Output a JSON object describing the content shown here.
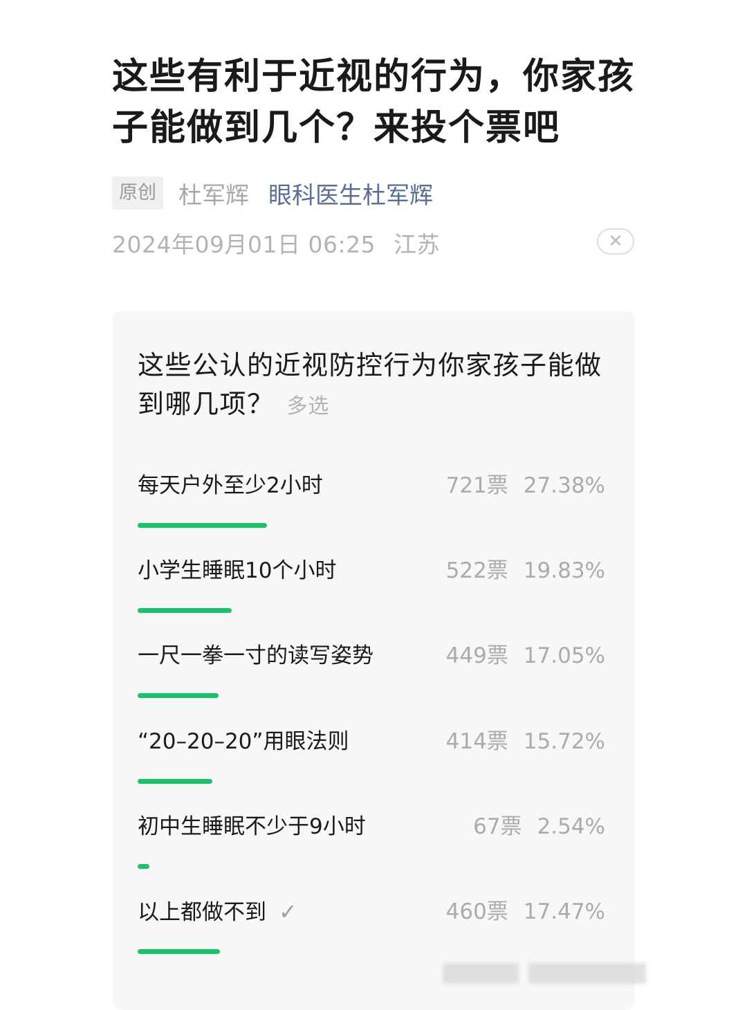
{
  "article": {
    "title": "这些有利于近视的行为，你家孩子能做到几个？来投个票吧",
    "original_badge": "原创",
    "author": "杜军辉",
    "account": "眼科医生杜军辉",
    "datetime": "2024年09月01日 06:25",
    "location": "江苏",
    "close_icon": "close-icon"
  },
  "vote": {
    "question": "这些公认的近视防控行为你家孩子能做到哪几项？",
    "type_tag": "多选",
    "options": [
      {
        "label": "每天户外至少2小时",
        "votes": "721票",
        "percent": "27.38%",
        "fraction": 0.2738
      },
      {
        "label": "小学生睡眠10个小时",
        "votes": "522票",
        "percent": "19.83%",
        "fraction": 0.1983
      },
      {
        "label": "一尺一拳一寸的读写姿势",
        "votes": "449票",
        "percent": "17.05%",
        "fraction": 0.1705
      },
      {
        "label": "“20–20–20”用眼法则",
        "votes": "414票",
        "percent": "15.72%",
        "fraction": 0.1572
      },
      {
        "label": "初中生睡眠不少于9小时",
        "votes": "67票",
        "percent": "2.54%",
        "fraction": 0.0254
      },
      {
        "label": "以上都做不到",
        "votes": "460票",
        "percent": "17.47%",
        "fraction": 0.1747,
        "checked": true
      }
    ],
    "bar_color": "#1ec16b"
  }
}
